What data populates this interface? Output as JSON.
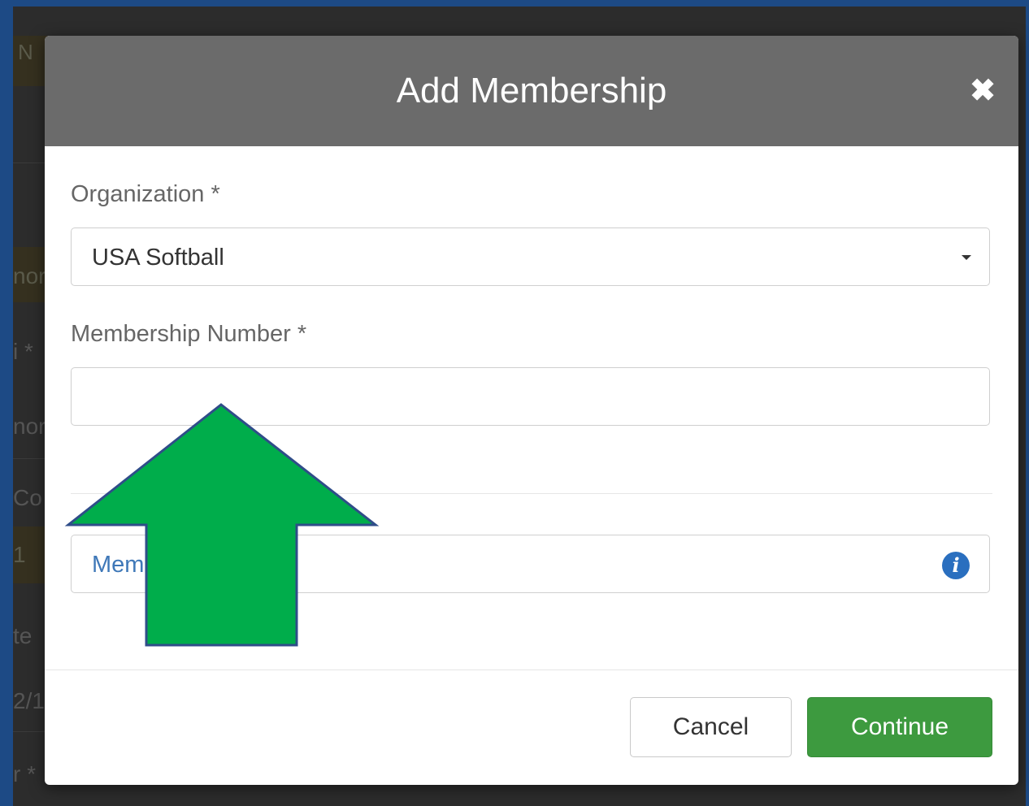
{
  "background_fragments": [
    "N",
    "nor",
    "i *",
    "nor",
    "Co",
    "1",
    "te",
    "2/1",
    "r *"
  ],
  "modal": {
    "title": "Add Membership",
    "close_icon": "close-icon",
    "organization": {
      "label": "Organization *",
      "selected": "USA Softball"
    },
    "membership_number": {
      "label": "Membership Number *",
      "value": ""
    },
    "info_link": {
      "text": "Mem",
      "icon": "info-icon"
    },
    "buttons": {
      "cancel": "Cancel",
      "continue": "Continue"
    }
  },
  "annotation": {
    "shape": "up-arrow",
    "fill_color": "#00ad4b",
    "stroke_color": "#2f4d89"
  },
  "colors": {
    "header_bg": "#6b6b6b",
    "continue_bg": "#3d9a3f",
    "link": "#3f78b8",
    "page_border": "#1d4a85"
  }
}
